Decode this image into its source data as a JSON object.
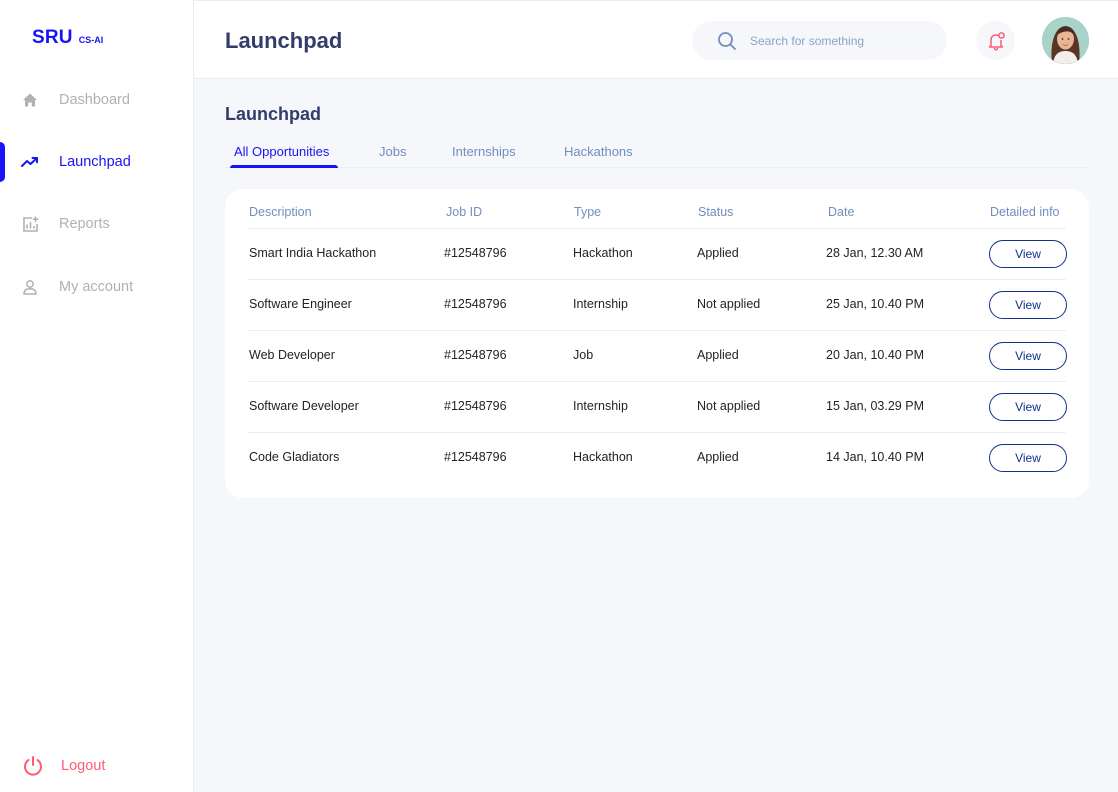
{
  "brand": {
    "name": "SRU",
    "sub": "CS-AI"
  },
  "sidebar": {
    "items": [
      {
        "label": "Dashboard",
        "icon": "home-icon"
      },
      {
        "label": "Launchpad",
        "icon": "trending-up-icon",
        "active": true
      },
      {
        "label": "Reports",
        "icon": "chart-add-icon"
      },
      {
        "label": "My account",
        "icon": "user-icon"
      }
    ],
    "logout": {
      "label": "Logout",
      "icon": "power-icon"
    }
  },
  "header": {
    "title": "Launchpad",
    "search": {
      "placeholder": "Search for something",
      "value": ""
    }
  },
  "main": {
    "title": "Launchpad",
    "tabs": [
      {
        "label": "All Opportunities",
        "active": true
      },
      {
        "label": "Jobs"
      },
      {
        "label": "Internships"
      },
      {
        "label": "Hackathons"
      }
    ],
    "table": {
      "columns": [
        "Description",
        "Job ID",
        "Type",
        "Status",
        "Date",
        "Detailed info"
      ],
      "rows": [
        {
          "description": "Smart India Hackathon",
          "job_id": "#12548796",
          "type": "Hackathon",
          "status": "Applied",
          "date": "28 Jan, 12.30 AM",
          "action": "View"
        },
        {
          "description": "Software Engineer",
          "job_id": "#12548796",
          "type": "Internship",
          "status": "Not applied",
          "date": "25 Jan, 10.40 PM",
          "action": "View"
        },
        {
          "description": "Web Developer",
          "job_id": "#12548796",
          "type": "Job",
          "status": "Applied",
          "date": "20 Jan, 10.40 PM",
          "action": "View"
        },
        {
          "description": "Software Developer",
          "job_id": "#12548796",
          "type": "Internship",
          "status": "Not applied",
          "date": "15 Jan, 03.29 PM",
          "action": "View"
        },
        {
          "description": "Code Gladiators",
          "job_id": "#12548796",
          "type": "Hackathon",
          "status": "Applied",
          "date": "14 Jan, 10.40 PM",
          "action": "View"
        }
      ]
    }
  },
  "colors": {
    "accent": "#1814f3",
    "title": "#343c6a",
    "muted": "#718ebf",
    "danger": "#fe5c73"
  }
}
